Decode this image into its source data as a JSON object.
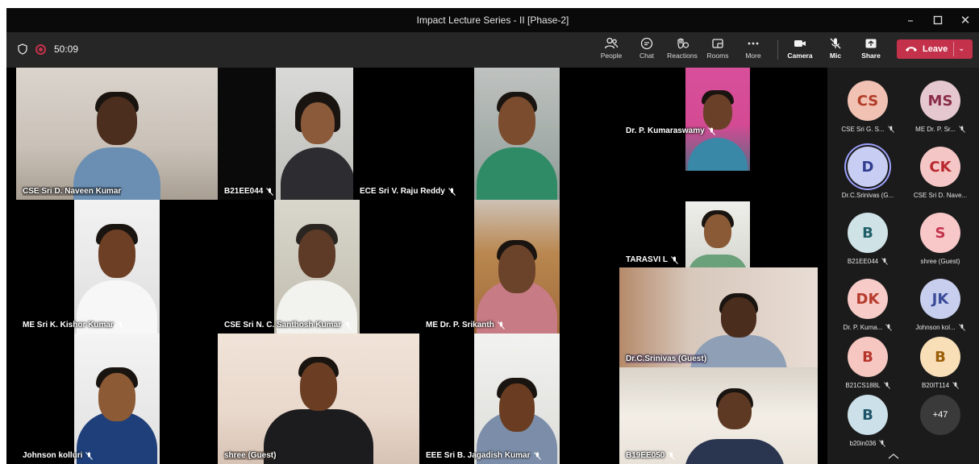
{
  "window": {
    "title": "Impact Lecture Series - II [Phase-2]"
  },
  "toolbar": {
    "timer": "50:09",
    "buttons": {
      "people": "People",
      "chat": "Chat",
      "reactions": "Reactions",
      "rooms": "Rooms",
      "more": "More",
      "camera": "Camera",
      "mic": "Mic",
      "share": "Share"
    },
    "leave_label": "Leave"
  },
  "stage": {
    "tiles": [
      {
        "name": "CSE Sri D. Naveen Kumar"
      },
      {
        "name": "B21EE044"
      },
      {
        "name": "ECE Sri V. Raju Reddy"
      },
      {
        "name": "Dr. P. Kumaraswamy"
      },
      {
        "name": "ME Sri K. Kishor Kumar"
      },
      {
        "name": "CSE Sri N. C. Santhosh Kumar"
      },
      {
        "name": "ME Dr. P. Srikanth"
      },
      {
        "name": "TARASVI L"
      },
      {
        "name": "Dr.C.Srinivas (Guest)"
      },
      {
        "name": "Johnson kolluri"
      },
      {
        "name": "shree (Guest)"
      },
      {
        "name": "EEE Sri B. Jagadish Kumar"
      },
      {
        "name": "B19EE050"
      }
    ]
  },
  "panel": {
    "participants": [
      {
        "initials": "CS",
        "label": "CSE Sri G. S...",
        "color": "#f1c1b3",
        "text_color": "#b13c28"
      },
      {
        "initials": "MS",
        "label": "ME Dr. P. Sr...",
        "color": "#e5c7cf",
        "text_color": "#8a2e48"
      },
      {
        "initials": "D",
        "label": "Dr.C.Srinivas (G...",
        "color": "#c7cdf3",
        "text_color": "#303d8f"
      },
      {
        "initials": "CK",
        "label": "CSE Sri D. Nave...",
        "color": "#f5c6c6",
        "text_color": "#b8282c"
      },
      {
        "initials": "B",
        "label": "B21EE044",
        "color": "#cfe3e6",
        "text_color": "#1f5f68"
      },
      {
        "initials": "S",
        "label": "shree (Guest)",
        "color": "#f8c8c8",
        "text_color": "#c4314b"
      },
      {
        "initials": "DK",
        "label": "Dr. P. Kuma...",
        "color": "#f6cbc8",
        "text_color": "#b73a2c"
      },
      {
        "initials": "JK",
        "label": "Johnson kol...",
        "color": "#c8cfee",
        "text_color": "#3b4a99"
      },
      {
        "initials": "B",
        "label": "B21CS188L",
        "color": "#f6c7c0",
        "text_color": "#b5352b"
      },
      {
        "initials": "B",
        "label": "B20IT114",
        "color": "#f9dfb8",
        "text_color": "#9a5d08"
      },
      {
        "initials": "B",
        "label": "b20in036",
        "color": "#cbe0e8",
        "text_color": "#1d5568"
      }
    ],
    "more_count": "+47"
  }
}
